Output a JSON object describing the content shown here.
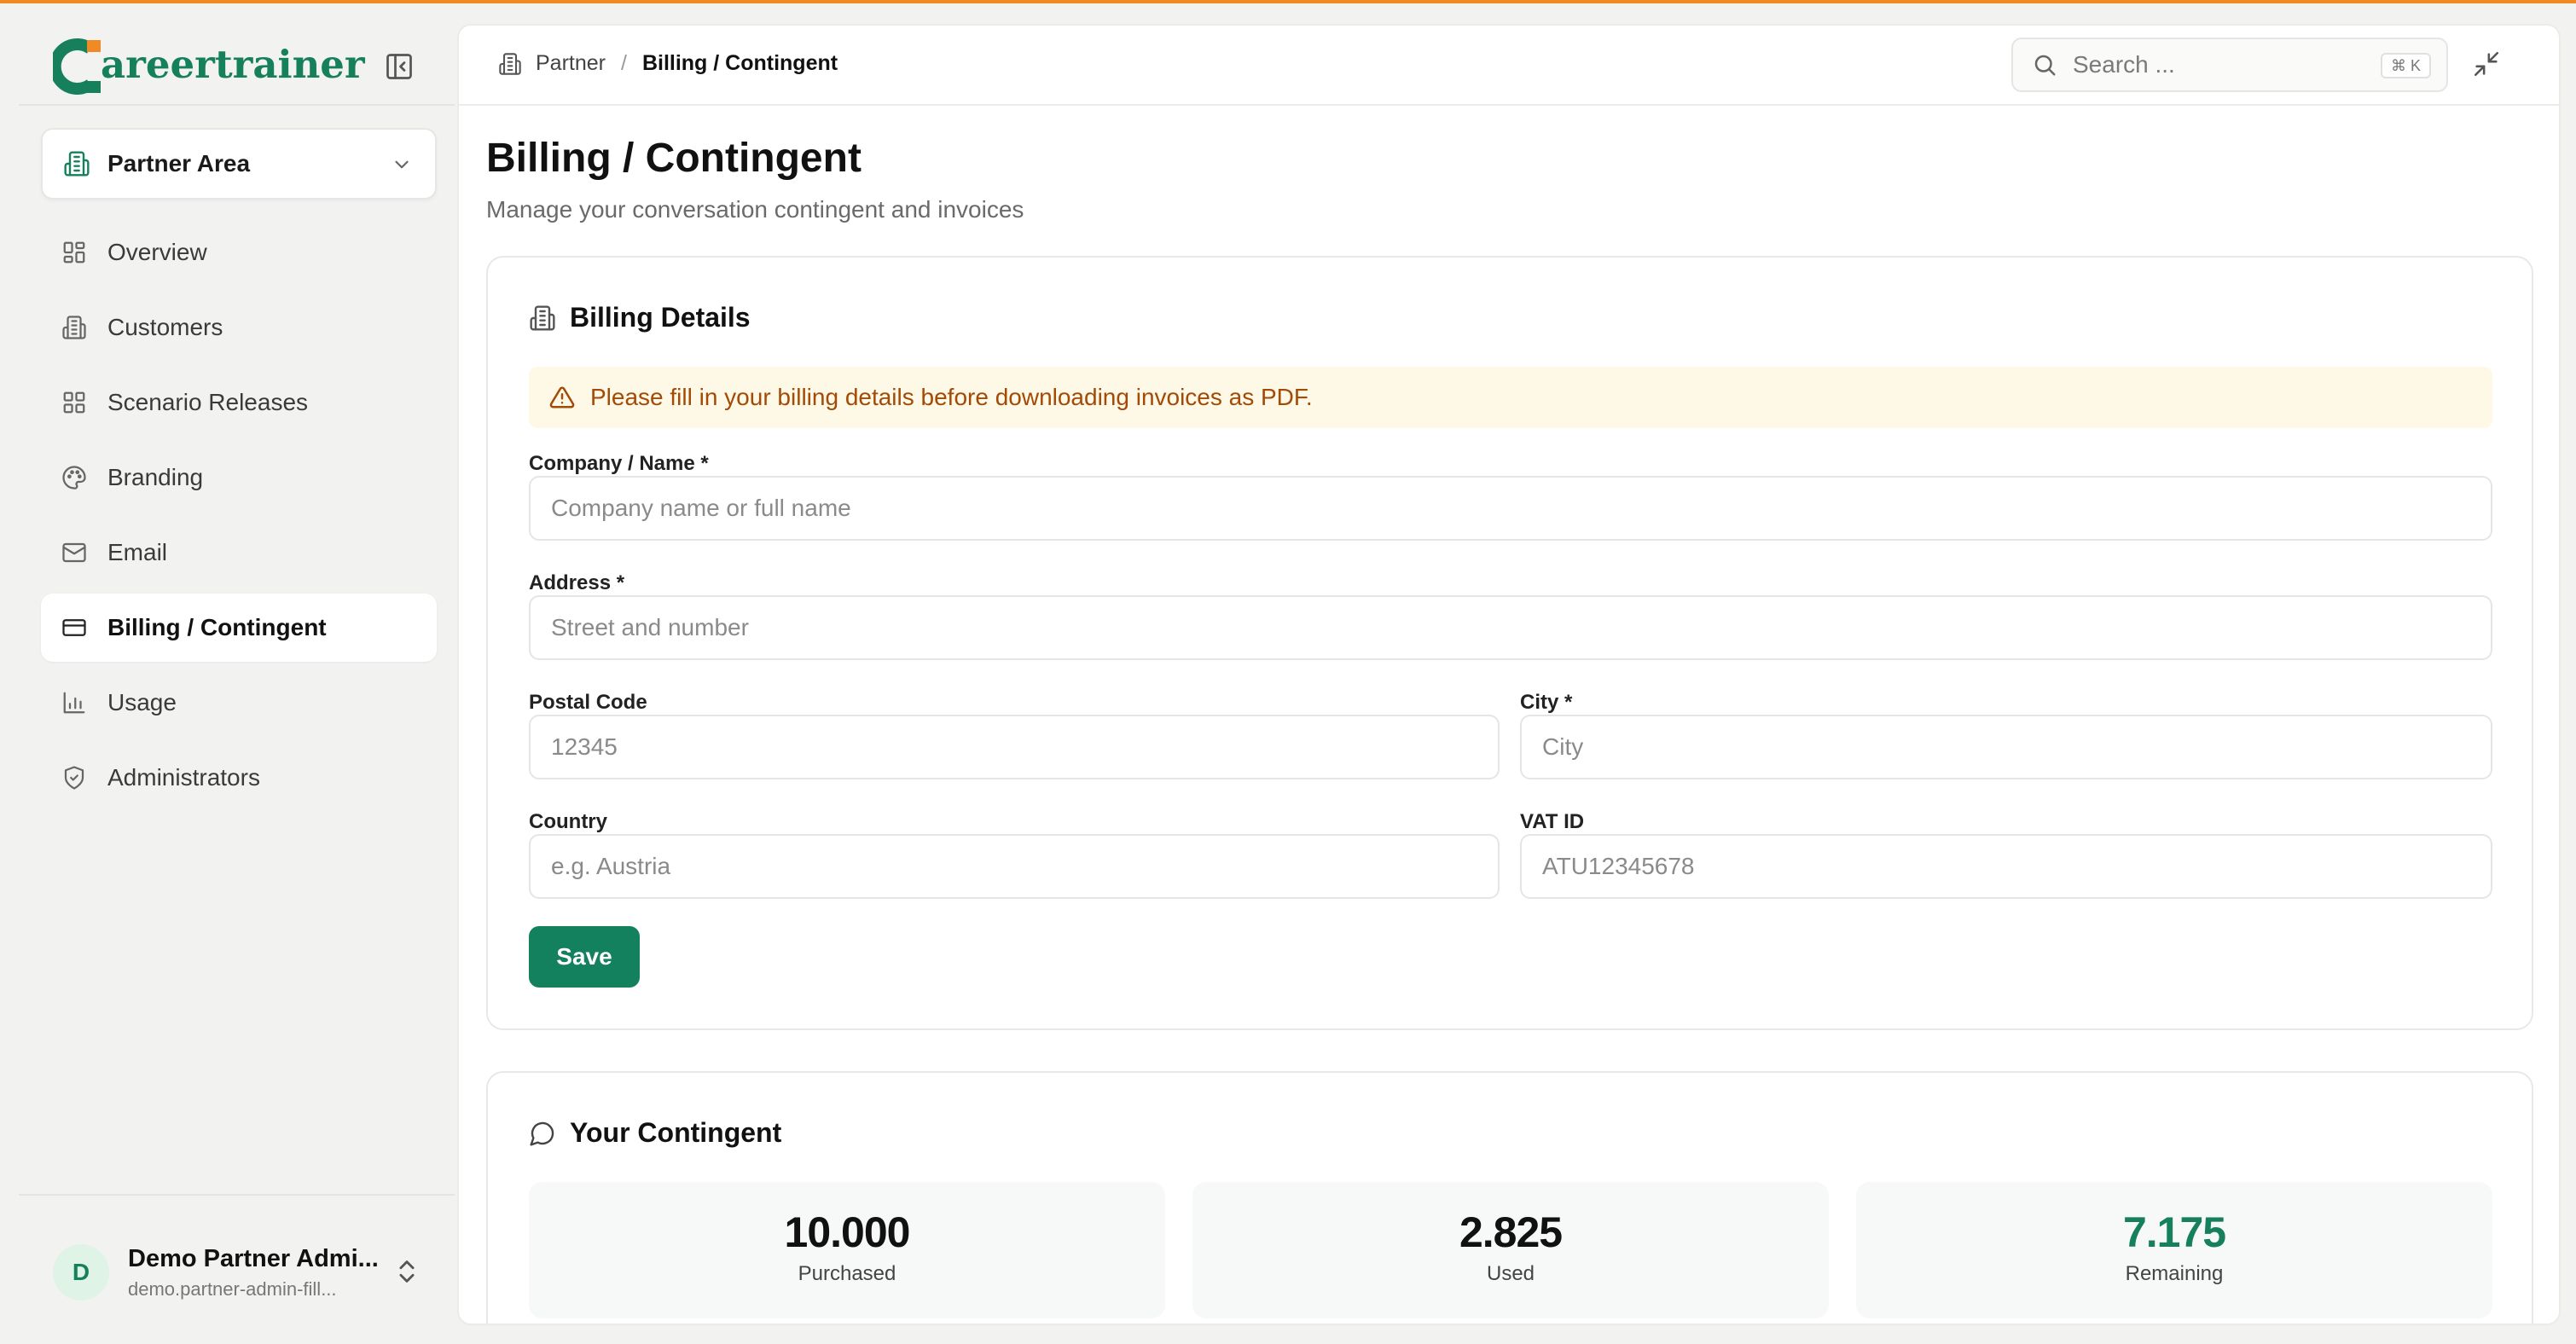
{
  "brand": {
    "logo_text": "areertrainer",
    "accent": "#16805d",
    "top_line_color": "#f08a24"
  },
  "sidebar": {
    "area_selector": {
      "label": "Partner Area",
      "icon": "building-icon"
    },
    "items": [
      {
        "label": "Overview",
        "icon": "grid-icon",
        "active": false
      },
      {
        "label": "Customers",
        "icon": "building-icon",
        "active": false
      },
      {
        "label": "Scenario Releases",
        "icon": "grid-icon",
        "active": false
      },
      {
        "label": "Branding",
        "icon": "palette-icon",
        "active": false
      },
      {
        "label": "Email",
        "icon": "mail-icon",
        "active": false
      },
      {
        "label": "Billing / Contingent",
        "icon": "credit-card-icon",
        "active": true
      },
      {
        "label": "Usage",
        "icon": "bar-chart-icon",
        "active": false
      },
      {
        "label": "Administrators",
        "icon": "shield-icon",
        "active": false
      }
    ],
    "user": {
      "initial": "D",
      "name": "Demo Partner Admi...",
      "email": "demo.partner-admin-fill..."
    }
  },
  "topbar": {
    "breadcrumb": {
      "parent": "Partner",
      "separator": "/",
      "current": "Billing / Contingent"
    },
    "search": {
      "placeholder": "Search ...",
      "shortcut": "⌘ K"
    }
  },
  "page": {
    "title": "Billing / Contingent",
    "subtitle": "Manage your conversation contingent and invoices"
  },
  "billing": {
    "title": "Billing Details",
    "alert": "Please fill in your billing details before downloading invoices as PDF.",
    "fields": {
      "company": {
        "label": "Company / Name *",
        "placeholder": "Company name or full name",
        "value": ""
      },
      "address": {
        "label": "Address *",
        "placeholder": "Street and number",
        "value": ""
      },
      "postal": {
        "label": "Postal Code",
        "placeholder": "12345",
        "value": ""
      },
      "city": {
        "label": "City *",
        "placeholder": "City",
        "value": ""
      },
      "country": {
        "label": "Country",
        "placeholder": "e.g. Austria",
        "value": ""
      },
      "vat": {
        "label": "VAT ID",
        "placeholder": "ATU12345678",
        "value": ""
      }
    },
    "save_label": "Save"
  },
  "contingent": {
    "title": "Your Contingent",
    "stats": [
      {
        "value": "10.000",
        "label": "Purchased"
      },
      {
        "value": "2.825",
        "label": "Used"
      },
      {
        "value": "7.175",
        "label": "Remaining"
      }
    ]
  }
}
